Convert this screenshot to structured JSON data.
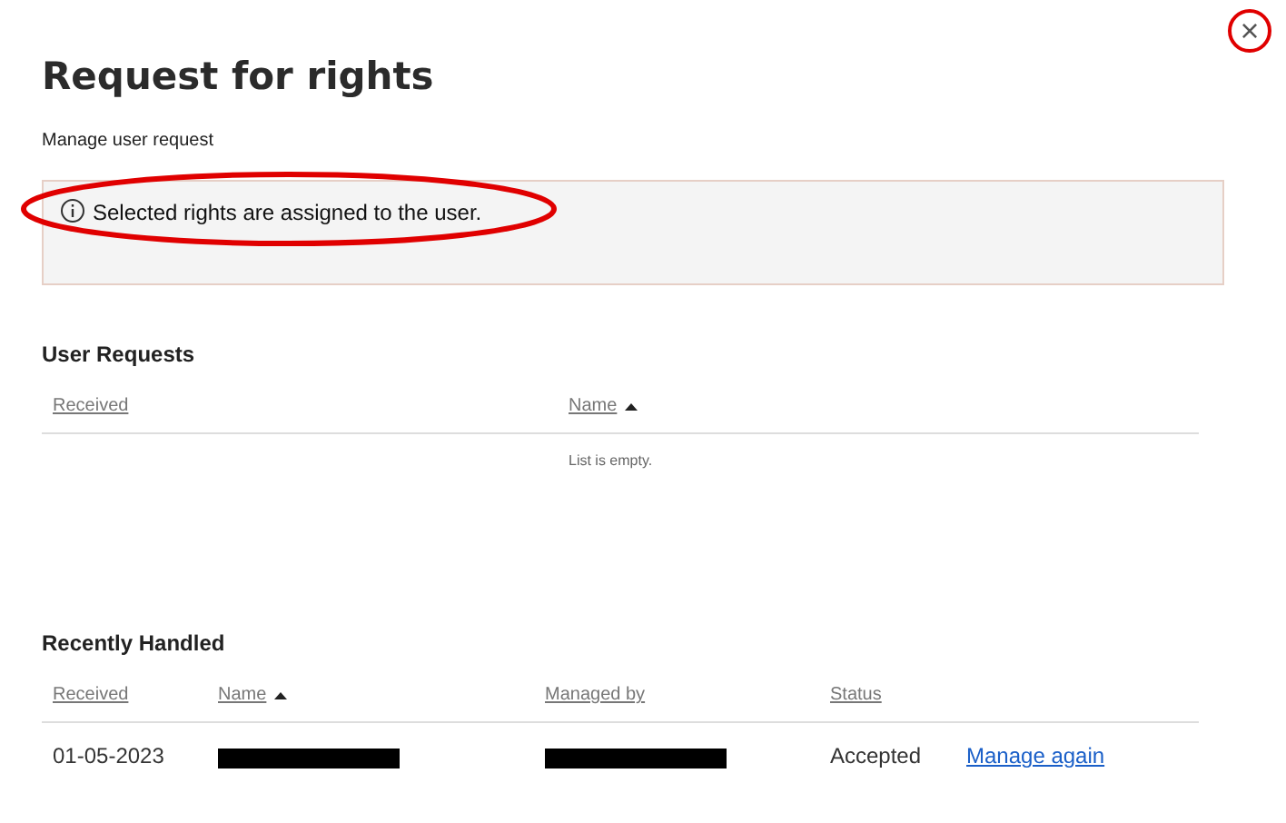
{
  "dialog": {
    "title": "Request for rights",
    "subtitle": "Manage user request",
    "close_label": "×"
  },
  "alert": {
    "message": "Selected rights are assigned to the user."
  },
  "user_requests": {
    "heading": "User Requests",
    "columns": [
      {
        "label": "Received",
        "sorted": false
      },
      {
        "label": "Name",
        "sorted": true
      }
    ],
    "empty_text": "List is empty."
  },
  "recently_handled": {
    "heading": "Recently Handled",
    "columns": [
      {
        "label": "Received",
        "sorted": false
      },
      {
        "label": "Name",
        "sorted": true
      },
      {
        "label": "Managed by",
        "sorted": false
      },
      {
        "label": "Status",
        "sorted": false
      }
    ],
    "rows": [
      {
        "cells": [
          {
            "kind": "text",
            "text": "01-05-2023"
          },
          {
            "kind": "redacted"
          },
          {
            "kind": "redacted"
          },
          {
            "kind": "text",
            "text": "Accepted"
          },
          {
            "kind": "link",
            "text": "Manage again"
          }
        ]
      }
    ]
  }
}
